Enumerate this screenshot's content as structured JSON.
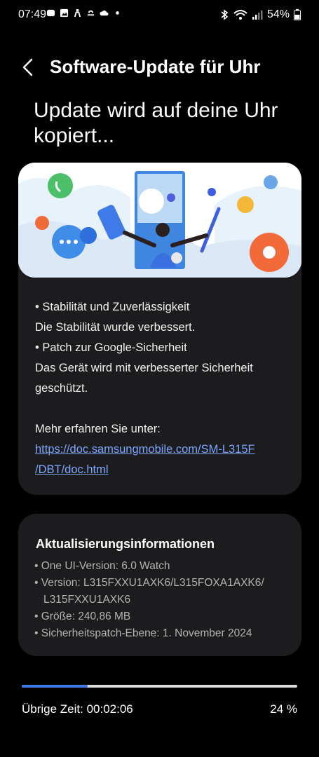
{
  "status_bar": {
    "time": "07:49",
    "battery": "54%"
  },
  "header": {
    "title": "Software-Update für Uhr"
  },
  "headline": "Update wird auf deine Uhr kopiert...",
  "notes": {
    "lines": [
      "• Stabilität und Zuverlässigkeit",
      "Die Stabilität wurde verbessert.",
      "• Patch zur Google-Sicherheit",
      "Das Gerät wird mit verbesserter Sicherheit",
      "geschützt."
    ],
    "more_label": "Mehr erfahren Sie unter:",
    "link_line1": "https://doc.samsungmobile.com/SM-L315F",
    "link_line2": "/DBT/doc.html"
  },
  "update_info": {
    "title": "Aktualisierungsinformationen",
    "items": [
      "• One UI-Version: 6.0 Watch",
      "• Version: L315FXXU1AXK6/L315FOXA1AXK6/",
      "L315FXXU1AXK6",
      "• Größe: 240,86 MB",
      "• Sicherheitspatch-Ebene: 1. November 2024"
    ]
  },
  "progress": {
    "fraction": 0.24,
    "remaining": "Übrige Zeit: 00:02:06",
    "percent": "24 %"
  },
  "colors": {
    "accent": "#3f7be8",
    "link": "#7ea8ff",
    "card": "#1c1c1f"
  }
}
